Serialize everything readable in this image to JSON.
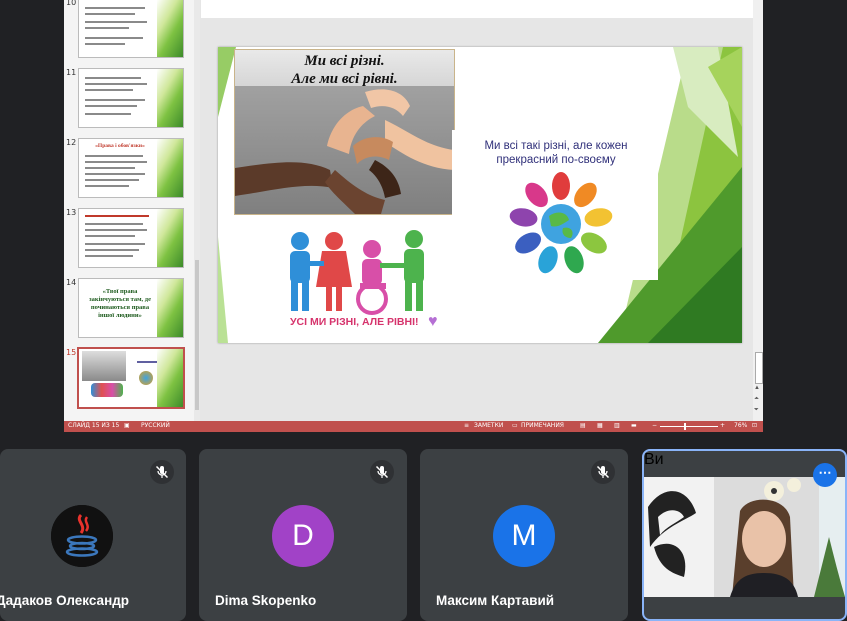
{
  "thumbnails": [
    {
      "num": "10",
      "title": ""
    },
    {
      "num": "11",
      "title": ""
    },
    {
      "num": "12",
      "title": "«Права і обов'язки»"
    },
    {
      "num": "13",
      "title": ""
    },
    {
      "num": "14",
      "title": "«Твої права закінчуються там, де починаються права іншої людини»"
    },
    {
      "num": "15",
      "title": ""
    }
  ],
  "slide": {
    "hands_title": "Ми всі різні.\nАле ми всі рівні.",
    "text": "Ми всі такі різні, але кожен прекрасний по-своєму",
    "kids_caption": "УСІ МИ РІЗНІ, АЛЕ РІВНІ!"
  },
  "status": {
    "slide": "СЛАЙД 15 ИЗ 15",
    "lang": "РУССКИЙ",
    "notes": "ЗАМЕТКИ",
    "comments": "ПРИМЕЧАНИЯ",
    "zoom": "76%"
  },
  "participants": [
    {
      "name": "Дадаков Олександр"
    },
    {
      "name": "Dima Skopenko",
      "initial": "D"
    },
    {
      "name": "Максим Картавий",
      "initial": "M"
    }
  ],
  "self": {
    "name": "Ви"
  },
  "colors": {
    "accent_red": "#c0504d",
    "tile_bg": "#3c4043",
    "self_border": "#8ab4f8",
    "avatar_d": "#a142c7",
    "avatar_m": "#1a73e8"
  }
}
